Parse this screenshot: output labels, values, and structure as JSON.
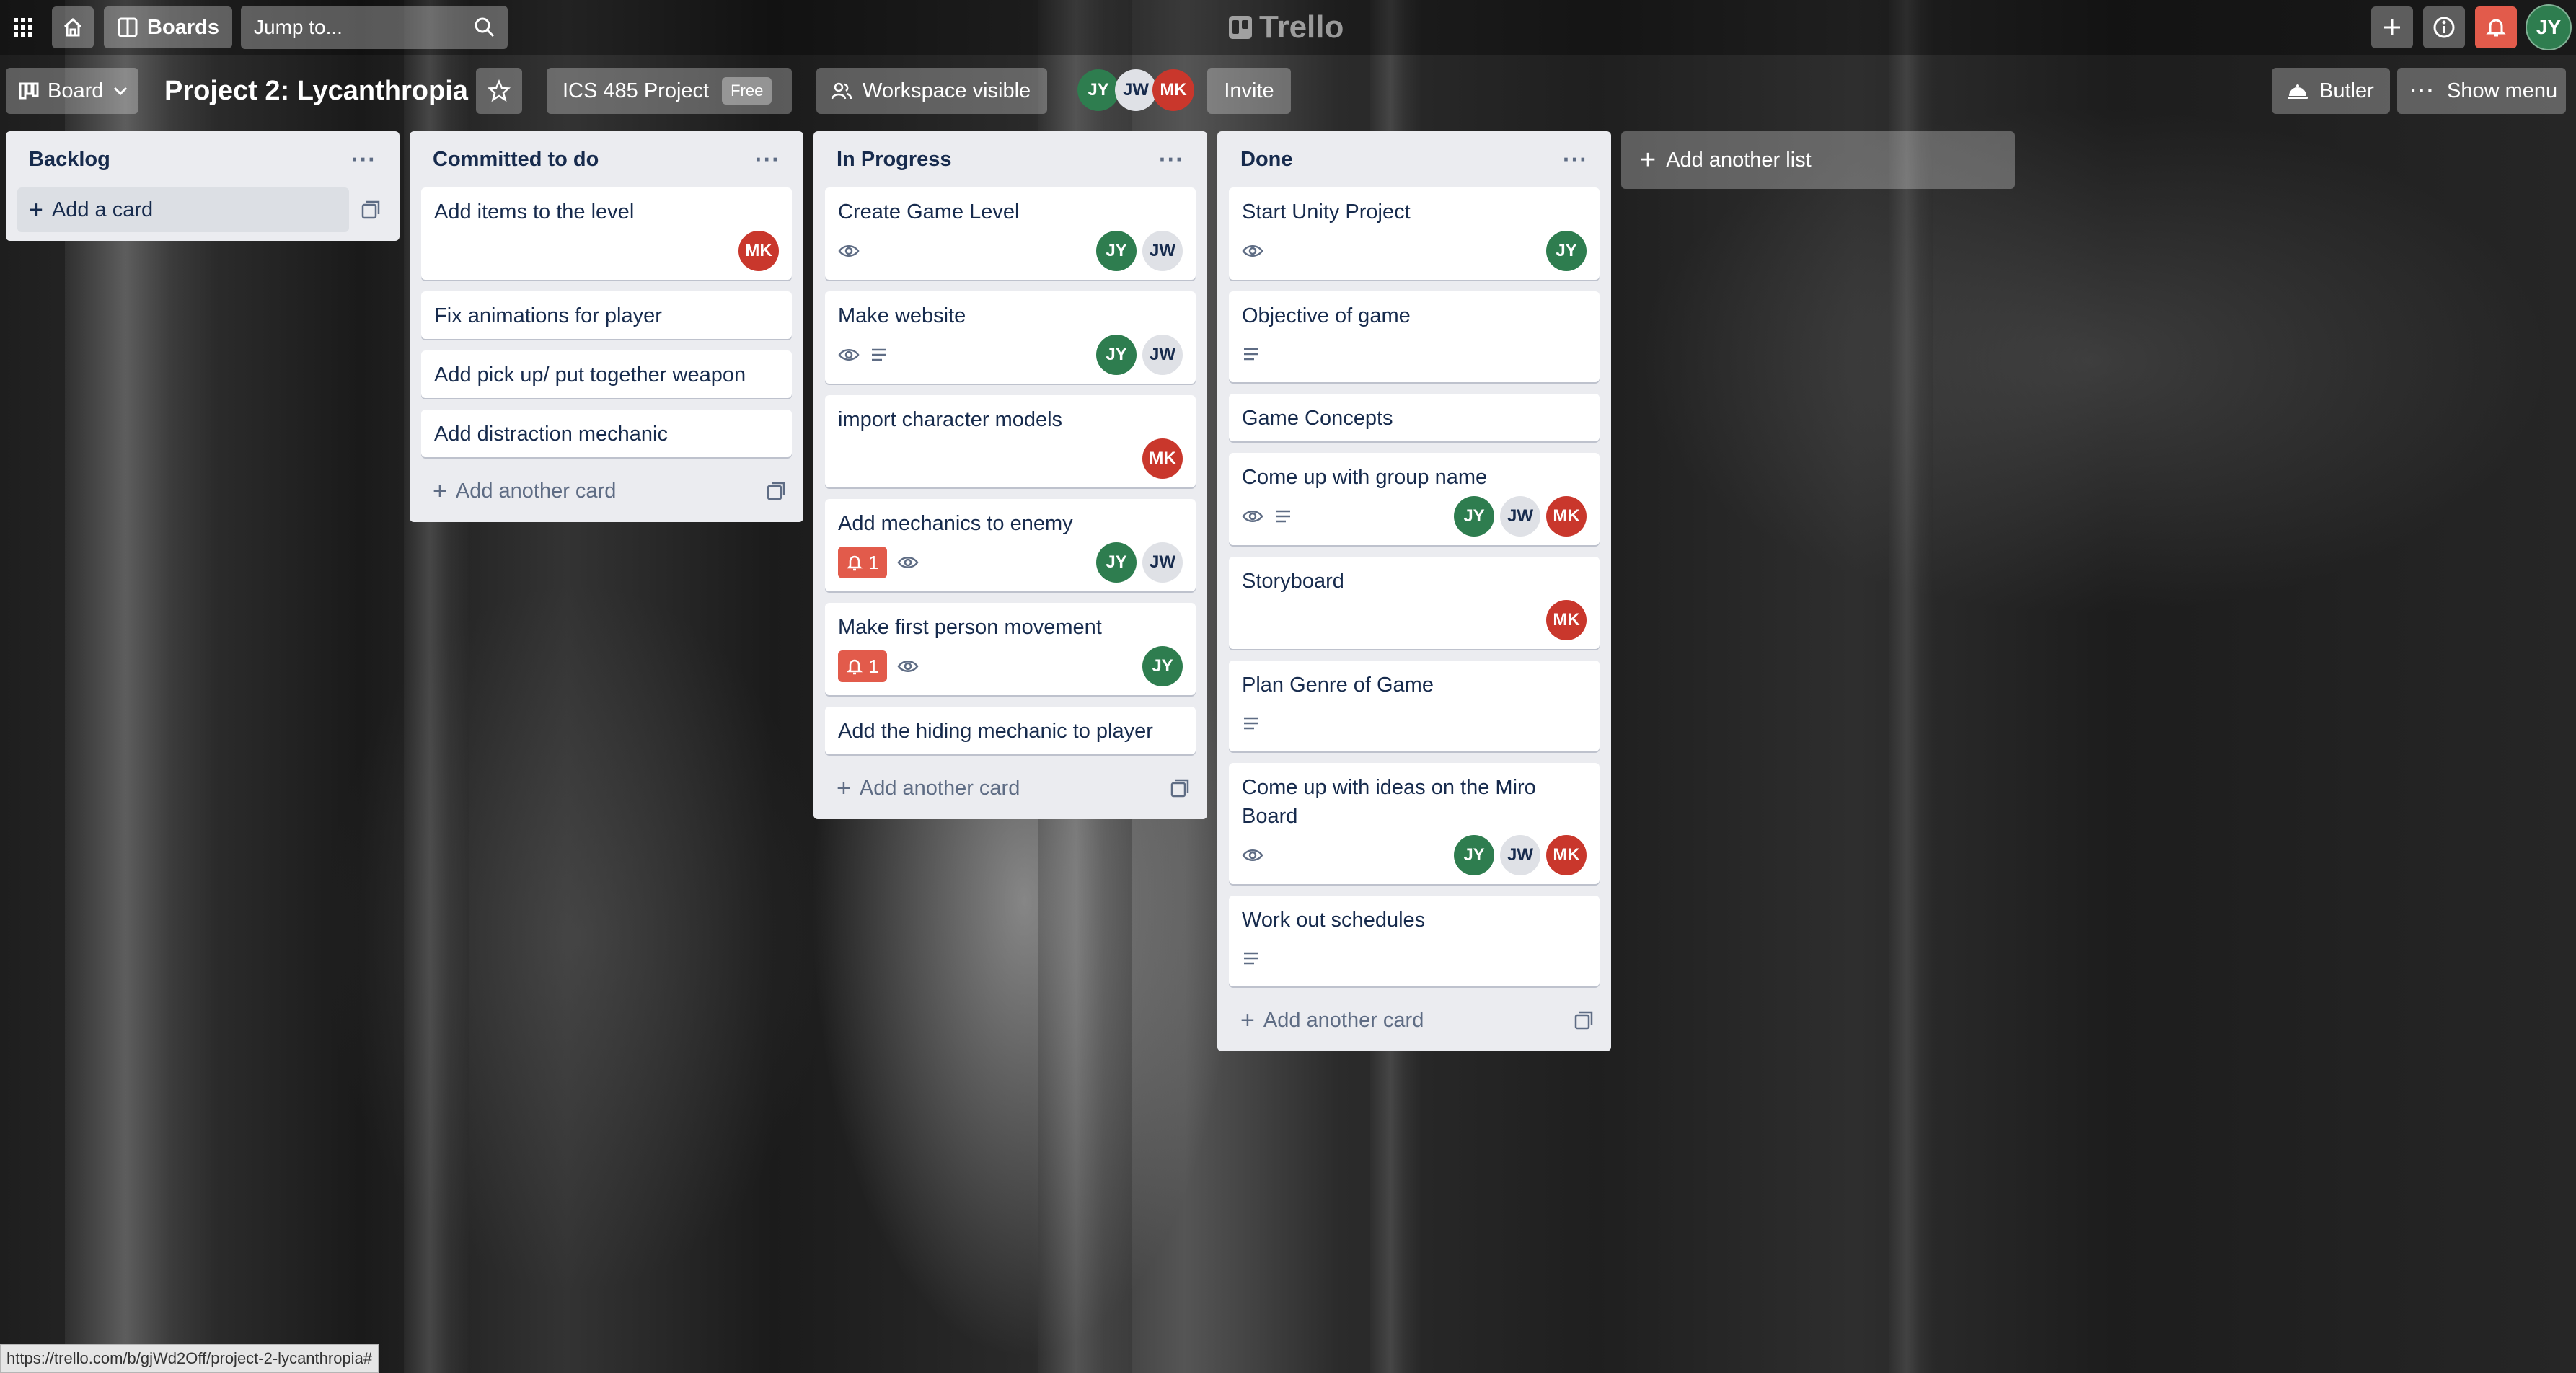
{
  "topbar": {
    "boards_label": "Boards",
    "search_placeholder": "Jump to...",
    "logo_text": "Trello",
    "user_initials": "JY"
  },
  "board_header": {
    "view_label": "Board",
    "title": "Project 2: Lycanthropia",
    "workspace_label": "ICS 485 Project",
    "plan_badge": "Free",
    "visibility_label": "Workspace visible",
    "members": [
      "JY",
      "JW",
      "MK"
    ],
    "invite_label": "Invite",
    "butler_label": "Butler",
    "show_menu_label": "Show menu"
  },
  "lists": [
    {
      "title": "Backlog",
      "add_label": "Add a card",
      "cards": []
    },
    {
      "title": "Committed to do",
      "add_label": "Add another card",
      "cards": [
        {
          "title": "Add items to the level",
          "members": [
            "MK"
          ]
        },
        {
          "title": "Fix animations for player",
          "members": []
        },
        {
          "title": "Add pick up/ put together weapon",
          "members": []
        },
        {
          "title": "Add distraction mechanic",
          "members": []
        }
      ]
    },
    {
      "title": "In Progress",
      "add_label": "Add another card",
      "cards": [
        {
          "title": "Create Game Level",
          "watch": true,
          "members": [
            "JY",
            "JW"
          ]
        },
        {
          "title": "Make website",
          "watch": true,
          "description": true,
          "members": [
            "JY",
            "JW"
          ]
        },
        {
          "title": "import character models",
          "members": [
            "MK"
          ]
        },
        {
          "title": "Add mechanics to enemy",
          "due_count": "1",
          "watch": true,
          "members": [
            "JY",
            "JW"
          ]
        },
        {
          "title": "Make first person movement",
          "due_count": "1",
          "watch": true,
          "members": [
            "JY"
          ]
        },
        {
          "title": "Add the hiding mechanic to player",
          "members": []
        }
      ]
    },
    {
      "title": "Done",
      "add_label": "Add another card",
      "cards": [
        {
          "title": "Start Unity Project",
          "watch": true,
          "members": [
            "JY"
          ]
        },
        {
          "title": "Objective of game",
          "description": true,
          "members": []
        },
        {
          "title": "Game Concepts",
          "members": []
        },
        {
          "title": "Come up with group name",
          "watch": true,
          "description": true,
          "members": [
            "JY",
            "JW",
            "MK"
          ]
        },
        {
          "title": "Storyboard",
          "members": [
            "MK"
          ]
        },
        {
          "title": "Plan Genre of Game",
          "description": true,
          "members": []
        },
        {
          "title": "Come up with ideas on the Miro Board",
          "watch": true,
          "members": [
            "JY",
            "JW",
            "MK"
          ]
        },
        {
          "title": "Work out schedules",
          "description": true,
          "members": []
        }
      ]
    }
  ],
  "add_list_label": "Add another list",
  "status_url": "https://trello.com/b/gjWd2Off/project-2-lycanthropia#",
  "colors": {
    "jy": "#2e7d4f",
    "jw": "#dfe1e6",
    "mk": "#c9372c",
    "due_badge": "#e25b4b",
    "list_bg": "#ebecf0"
  }
}
